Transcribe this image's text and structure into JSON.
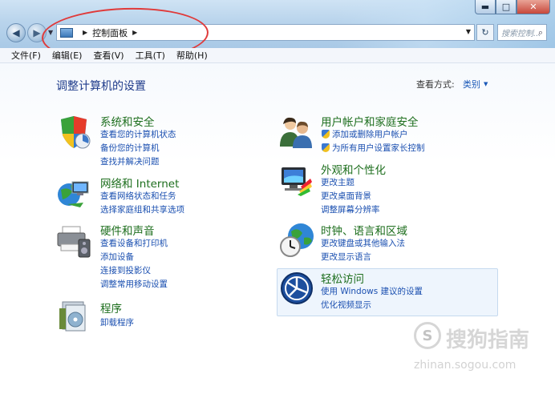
{
  "window": {
    "minimize": "▬",
    "maximize": "□",
    "close": "✕"
  },
  "address": {
    "path": "控制面板",
    "search_placeholder": "搜索控制..."
  },
  "menu": [
    "文件(F)",
    "编辑(E)",
    "查看(V)",
    "工具(T)",
    "帮助(H)"
  ],
  "page": {
    "title": "调整计算机的设置",
    "view_label": "查看方式:",
    "view_value": "类别"
  },
  "categories": [
    {
      "title": "系统和安全",
      "icon": "shield-icon",
      "links": [
        "查看您的计算机状态",
        "备份您的计算机",
        "查找并解决问题"
      ]
    },
    {
      "title": "网络和 Internet",
      "icon": "globe-network-icon",
      "links": [
        "查看网络状态和任务",
        "选择家庭组和共享选项"
      ]
    },
    {
      "title": "硬件和声音",
      "icon": "printer-icon",
      "links": [
        "查看设备和打印机",
        "添加设备",
        "连接到投影仪",
        "调整常用移动设置"
      ]
    },
    {
      "title": "程序",
      "icon": "programs-icon",
      "links": [
        "卸载程序"
      ]
    },
    {
      "title": "用户帐户和家庭安全",
      "icon": "users-icon",
      "links": [
        "添加或删除用户帐户",
        "为所有用户设置家长控制"
      ]
    },
    {
      "title": "外观和个性化",
      "icon": "monitor-paint-icon",
      "links": [
        "更改主题",
        "更改桌面背景",
        "调整屏幕分辨率"
      ]
    },
    {
      "title": "时钟、语言和区域",
      "icon": "clock-globe-icon",
      "links": [
        "更改键盘或其他输入法",
        "更改显示语言"
      ]
    },
    {
      "title": "轻松访问",
      "icon": "ease-of-access-icon",
      "links": [
        "使用 Windows 建议的设置",
        "优化视频显示"
      ]
    }
  ],
  "watermark": {
    "logo": "S",
    "text": "搜狗指南",
    "url": "zhinan.sogou.com"
  },
  "colors": {
    "category_title": "#1d6e1d",
    "link": "#1a4fb0",
    "annotation": "#e03a3a"
  }
}
